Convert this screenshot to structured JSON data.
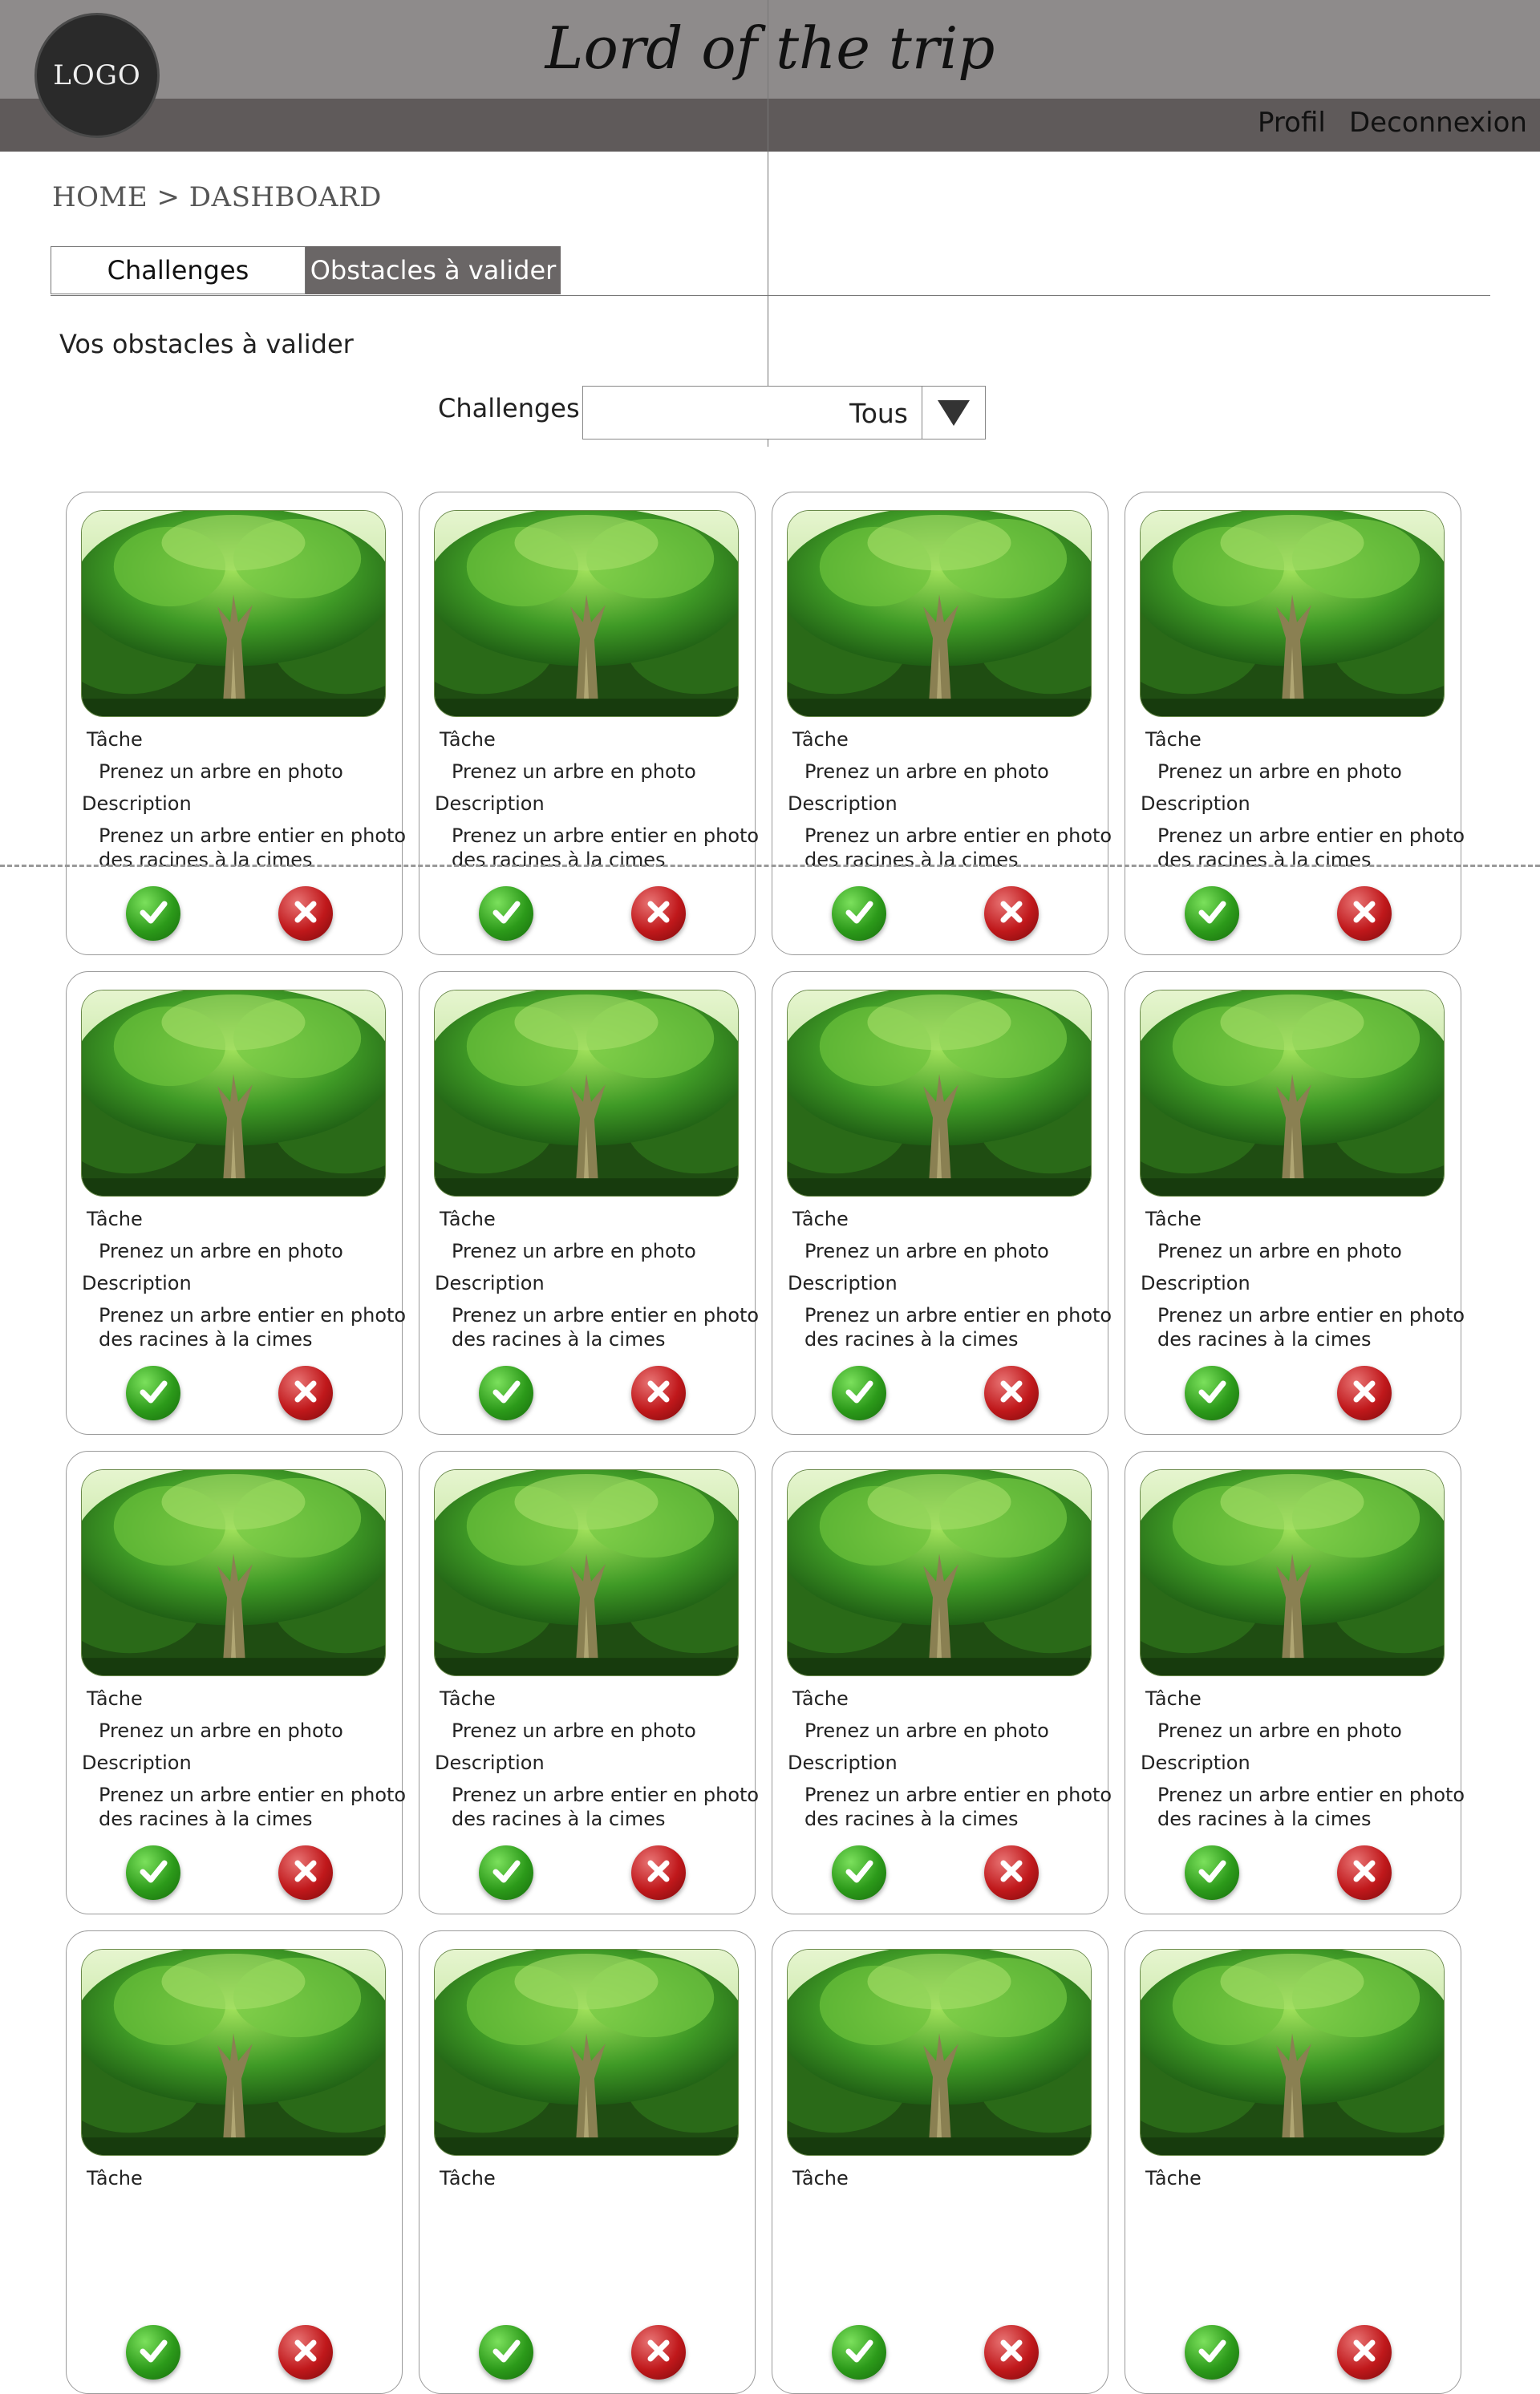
{
  "header": {
    "logo_text": "LOGO",
    "title": "Lord of the trip",
    "nav": {
      "profile": "Profil",
      "logout": "Deconnexion"
    }
  },
  "breadcrumb": "HOME > DASHBOARD",
  "tabs": [
    {
      "label": "Challenges",
      "active": false
    },
    {
      "label": "Obstacles à valider",
      "active": true
    }
  ],
  "section_title": "Vos obstacles à valider",
  "filter": {
    "label": "Challenges",
    "selected": "Tous"
  },
  "cards": [
    {
      "task_label": "Tâche",
      "task": "Prenez un arbre en photo",
      "desc_label": "Description",
      "desc_line1": "Prenez un arbre entier en photo",
      "desc_line2": "des racines à la cimes"
    },
    {
      "task_label": "Tâche",
      "task": "Prenez un arbre en photo",
      "desc_label": "Description",
      "desc_line1": "Prenez un arbre entier en photo",
      "desc_line2": "des racines à la cimes"
    },
    {
      "task_label": "Tâche",
      "task": "Prenez un arbre en photo",
      "desc_label": "Description",
      "desc_line1": "Prenez un arbre entier en photo",
      "desc_line2": "des racines à la cimes"
    },
    {
      "task_label": "Tâche",
      "task": "Prenez un arbre en photo",
      "desc_label": "Description",
      "desc_line1": "Prenez un arbre entier en photo",
      "desc_line2": "des racines à la cimes"
    },
    {
      "task_label": "Tâche",
      "task": "Prenez un arbre en photo",
      "desc_label": "Description",
      "desc_line1": "Prenez un arbre entier en photo",
      "desc_line2": "des racines à la cimes"
    },
    {
      "task_label": "Tâche",
      "task": "Prenez un arbre en photo",
      "desc_label": "Description",
      "desc_line1": "Prenez un arbre entier en photo",
      "desc_line2": "des racines à la cimes"
    },
    {
      "task_label": "Tâche",
      "task": "Prenez un arbre en photo",
      "desc_label": "Description",
      "desc_line1": "Prenez un arbre entier en photo",
      "desc_line2": "des racines à la cimes"
    },
    {
      "task_label": "Tâche",
      "task": "Prenez un arbre en photo",
      "desc_label": "Description",
      "desc_line1": "Prenez un arbre entier en photo",
      "desc_line2": "des racines à la cimes"
    },
    {
      "task_label": "Tâche",
      "task": "Prenez un arbre en photo",
      "desc_label": "Description",
      "desc_line1": "Prenez un arbre entier en photo",
      "desc_line2": "des racines à la cimes"
    },
    {
      "task_label": "Tâche",
      "task": "Prenez un arbre en photo",
      "desc_label": "Description",
      "desc_line1": "Prenez un arbre entier en photo",
      "desc_line2": "des racines à la cimes"
    },
    {
      "task_label": "Tâche",
      "task": "Prenez un arbre en photo",
      "desc_label": "Description",
      "desc_line1": "Prenez un arbre entier en photo",
      "desc_line2": "des racines à la cimes"
    },
    {
      "task_label": "Tâche",
      "task": "Prenez un arbre en photo",
      "desc_label": "Description",
      "desc_line1": "Prenez un arbre entier en photo",
      "desc_line2": "des racines à la cimes"
    },
    {
      "task_label": "Tâche",
      "task": "",
      "desc_label": "",
      "desc_line1": "",
      "desc_line2": ""
    },
    {
      "task_label": "Tâche",
      "task": "",
      "desc_label": "",
      "desc_line1": "",
      "desc_line2": ""
    },
    {
      "task_label": "Tâche",
      "task": "",
      "desc_label": "",
      "desc_line1": "",
      "desc_line2": ""
    },
    {
      "task_label": "Tâche",
      "task": "",
      "desc_label": "",
      "desc_line1": "",
      "desc_line2": ""
    }
  ],
  "icons": {
    "validate": "check-icon",
    "reject": "cross-icon",
    "dropdown": "triangle-down-icon"
  },
  "colors": {
    "header_top": "#8e8b8b",
    "header_bottom": "#5f5a5a",
    "active_tab": "#6a6666",
    "validate": "#2c9a1a",
    "reject": "#c0181b"
  }
}
